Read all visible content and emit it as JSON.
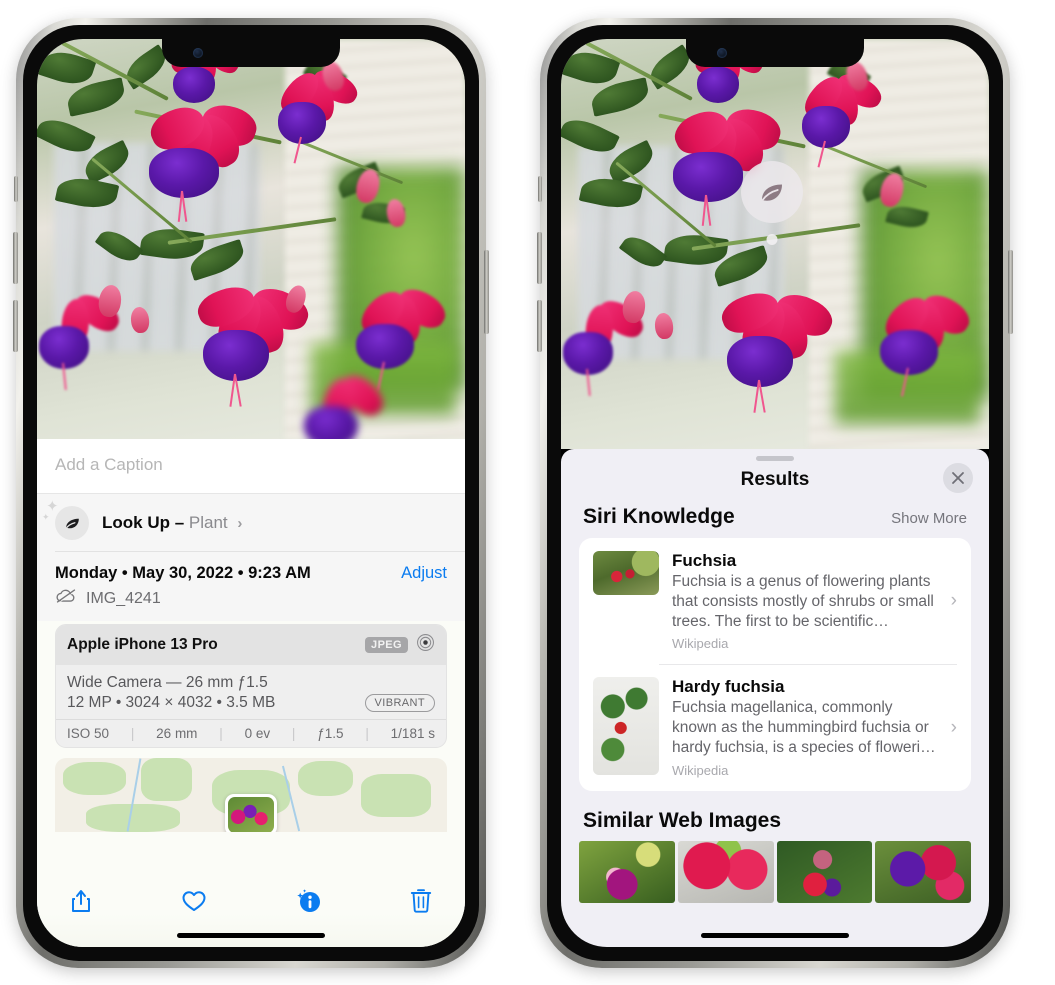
{
  "left_phone": {
    "photo": {
      "alt": "fuchsia-flowers-hanging-basket"
    },
    "caption_field": {
      "placeholder": "Add a Caption",
      "value": ""
    },
    "lookup_row": {
      "icon": "leaf-icon",
      "label": "Look Up –",
      "subject": "Plant",
      "chevron": "›"
    },
    "date_row": {
      "date": "Monday • May 30, 2022 • 9:23 AM",
      "adjust_label": "Adjust"
    },
    "file_row": {
      "icon": "cloud-slash-icon",
      "filename": "IMG_4241"
    },
    "exif": {
      "device": "Apple iPhone 13 Pro",
      "format_tag": "JPEG",
      "aperture_icon": "lens-icon",
      "lens_line": "Wide Camera — 26 mm ƒ1.5",
      "size_line": "12 MP • 3024 × 4032 • 3.5 MB",
      "style_tag": "VIBRANT",
      "settings": [
        "ISO 50",
        "26 mm",
        "0 ev",
        "ƒ1.5",
        "1/181 s"
      ]
    },
    "map": {
      "alt": "location-map-thumbnail"
    },
    "toolbar": [
      {
        "name": "share-icon",
        "label": "Share"
      },
      {
        "name": "heart-icon",
        "label": "Favorite"
      },
      {
        "name": "info-icon",
        "label": "Info"
      },
      {
        "name": "trash-icon",
        "label": "Delete"
      }
    ]
  },
  "right_phone": {
    "photo": {
      "alt": "fuchsia-flowers-hanging-basket"
    },
    "visual_lookup_badge": {
      "icon": "leaf-icon"
    },
    "sheet": {
      "title": "Results",
      "close_label": "✕",
      "sections": [
        {
          "title": "Siri Knowledge",
          "action_label": "Show More",
          "items": [
            {
              "title": "Fuchsia",
              "description": "Fuchsia is a genus of flowering plants that consists mostly of shrubs or small trees. The first to be scientific…",
              "source": "Wikipedia",
              "chevron": "›"
            },
            {
              "title": "Hardy fuchsia",
              "description": "Fuchsia magellanica, commonly known as the hummingbird fuchsia or hardy fuchsia, is a species of floweri…",
              "source": "Wikipedia",
              "chevron": "›"
            }
          ]
        },
        {
          "title": "Similar Web Images",
          "images": [
            {
              "alt": "fuchsia-web-image-1"
            },
            {
              "alt": "fuchsia-web-image-2"
            },
            {
              "alt": "fuchsia-web-image-3"
            },
            {
              "alt": "fuchsia-web-image-4"
            }
          ]
        }
      ]
    }
  },
  "colors": {
    "accent_blue": "#0b7cf0",
    "sheet_bg": "#f0eff5",
    "card_bg": "#ffffff",
    "info_bg": "#f6f6f6"
  }
}
